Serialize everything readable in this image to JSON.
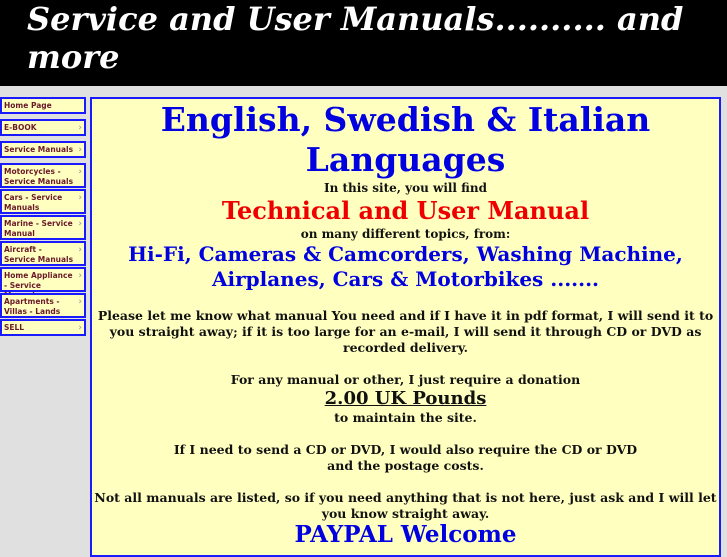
{
  "header": {
    "title": "Service and User Manuals.......... and more"
  },
  "nav": {
    "chevron": "›",
    "items": [
      {
        "label": "Home Page",
        "has_chevron": false
      },
      {
        "label": "E-BOOK",
        "has_chevron": true
      },
      {
        "label": "Service Manuals",
        "has_chevron": true
      },
      {
        "label": "Motorcycles - Service Manuals",
        "has_chevron": true
      },
      {
        "label": "Cars - Service Manuals",
        "has_chevron": true
      },
      {
        "label": "Marine - Service Manual",
        "has_chevron": true
      },
      {
        "label": "Aircraft - Service Manuals",
        "has_chevron": true
      },
      {
        "label": "Home Appliance - Service Manual",
        "has_chevron": true
      },
      {
        "label": "Apartments - Villas - Lands",
        "has_chevron": true
      },
      {
        "label": "SELL",
        "has_chevron": true
      }
    ]
  },
  "main": {
    "languages_heading": "English, Swedish & Italian Languages",
    "intro": "In this site, you will find",
    "manual_heading": "Technical and User Manual",
    "topics_intro": "on many different topics, from:",
    "topics": "Hi-Fi, Cameras & Camcorders, Washing Machine, Airplanes, Cars & Motorbikes .......",
    "request_text": "Please let me know what manual You need and if I have it in pdf format, I will send it to you straight away; if it is too large for an e-mail, I will send it through CD or DVD as recorded delivery.",
    "donation_intro": "For any manual or other, I just require a donation",
    "donation_amount": "2.00 UK Pounds ",
    "donation_purpose": "to maintain the site.",
    "cd_line1": "If I need to send a CD or DVD, I would also require the CD or DVD",
    "cd_line2": "and the postage costs.",
    "not_listed": "Not all manuals are listed, so if you need anything that is not here, just ask and I will let you know straight away.",
    "paypal": "PAYPAL Welcome"
  },
  "colors": {
    "header_bg": "#000000",
    "panel_bg": "#ffffc0",
    "border_blue": "#1a1aff",
    "heading_blue": "#0000e0",
    "heading_red": "#ee0000",
    "nav_text": "#6b1a2a"
  }
}
